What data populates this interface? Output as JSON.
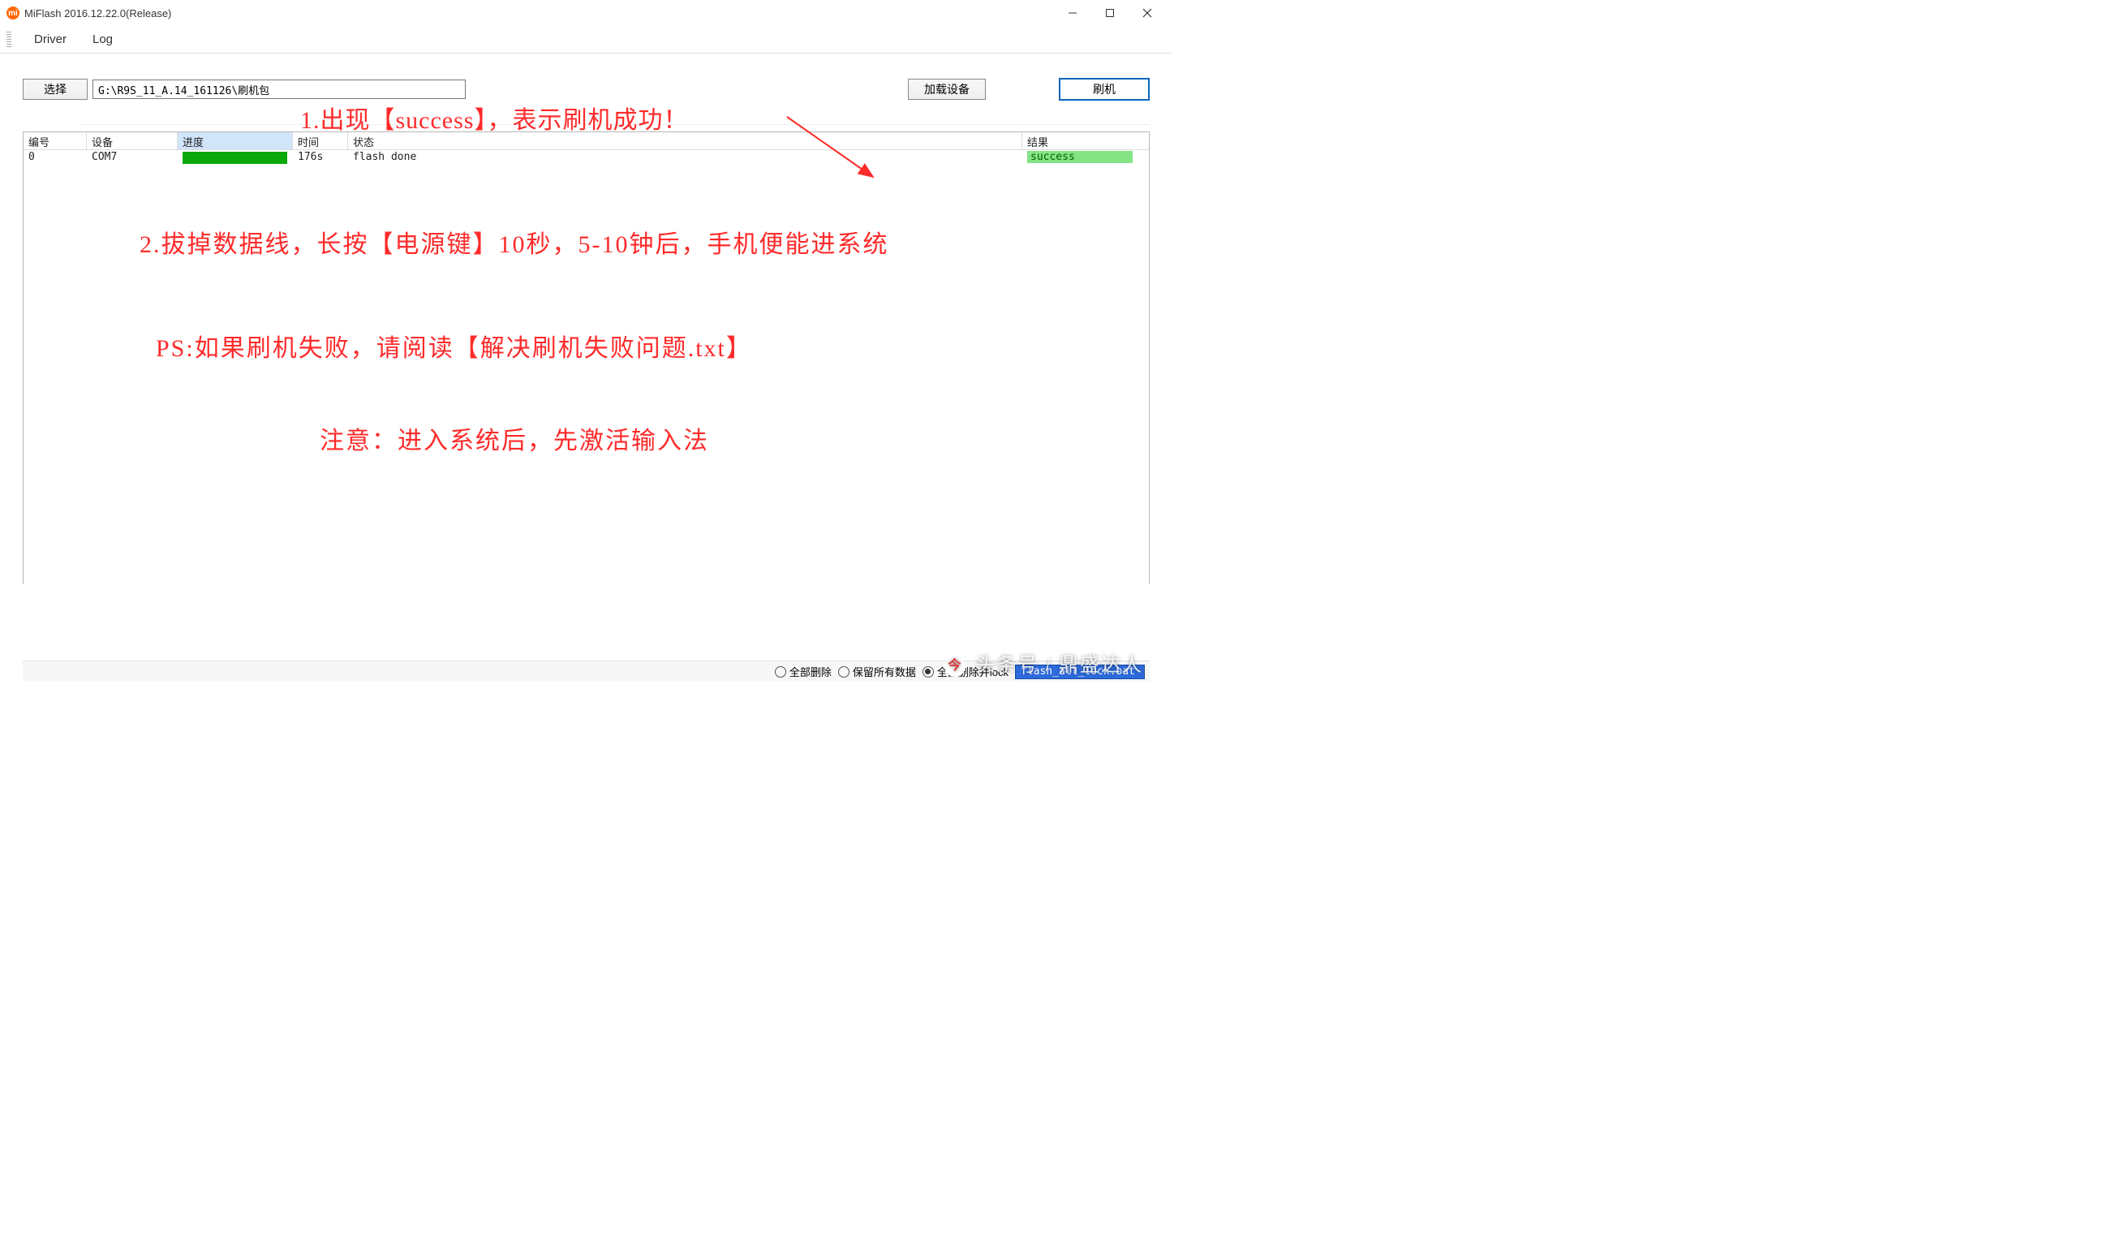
{
  "window": {
    "title": "MiFlash 2016.12.22.0(Release)"
  },
  "menubar": {
    "driver": "Driver",
    "log": "Log"
  },
  "toolbar": {
    "select_label": "选择",
    "path_value": "G:\\R9S_11_A.14_161126\\刷机包",
    "load_label": "加载设备",
    "flash_label": "刷机"
  },
  "table": {
    "headers": {
      "idx": "编号",
      "dev": "设备",
      "prog": "进度",
      "time": "时间",
      "stat": "状态",
      "res": "结果"
    },
    "rows": [
      {
        "idx": "0",
        "dev": "COM7",
        "prog_pct": 100,
        "time": "176s",
        "stat": "flash done",
        "res": "success"
      }
    ]
  },
  "annotations": {
    "line1": "1.出现【success】，表示刷机成功！",
    "line2": "2.拔掉数据线，长按【电源键】10秒，5-10钟后，手机便能进系统",
    "line3": "PS:如果刷机失败，请阅读【解决刷机失败问题.txt】",
    "line4": "注意：进入系统后，先激活输入法"
  },
  "statusbar": {
    "opt1": "全部删除",
    "opt2": "保留所有数据",
    "opt3": "全部删除并lock",
    "script": "flash_all_lock.bat"
  },
  "watermark": "头条号 / 鼎盛达人"
}
